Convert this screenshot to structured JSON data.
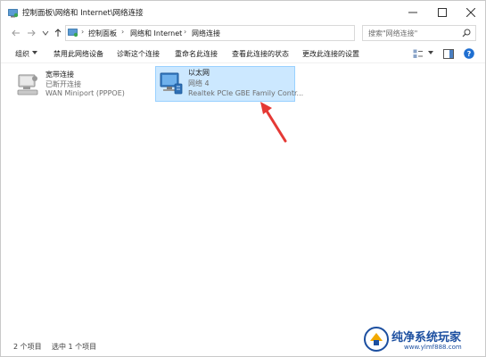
{
  "window": {
    "title": "控制面板\\网络和 Internet\\网络连接"
  },
  "address": {
    "crumbs": [
      "控制面板",
      "网络和 Internet",
      "网络连接"
    ]
  },
  "search": {
    "placeholder": "搜索\"网络连接\""
  },
  "toolbar": {
    "organize": "组织",
    "disable": "禁用此网络设备",
    "diagnose": "诊断这个连接",
    "rename": "重命名此连接",
    "view_status": "查看此连接的状态",
    "change_settings": "更改此连接的设置"
  },
  "connections": [
    {
      "name": "宽带连接",
      "status": "已断开连接",
      "device": "WAN Miniport (PPPOE)",
      "icon": "broadband-connection-icon",
      "selected": false
    },
    {
      "name": "以太网",
      "status": "网络 4",
      "device": "Realtek PCIe GBE Family Contr...",
      "icon": "ethernet-connection-icon",
      "selected": true
    }
  ],
  "statusbar": {
    "count": "2 个项目",
    "selected": "选中 1 个项目"
  },
  "watermark": {
    "text": "纯净系统玩家",
    "url": "www.ylmf888.com"
  },
  "colors": {
    "selection_bg": "#cce8ff",
    "selection_border": "#99d1ff",
    "annotation_arrow": "#e53935",
    "help_blue": "#1f6fd1"
  }
}
